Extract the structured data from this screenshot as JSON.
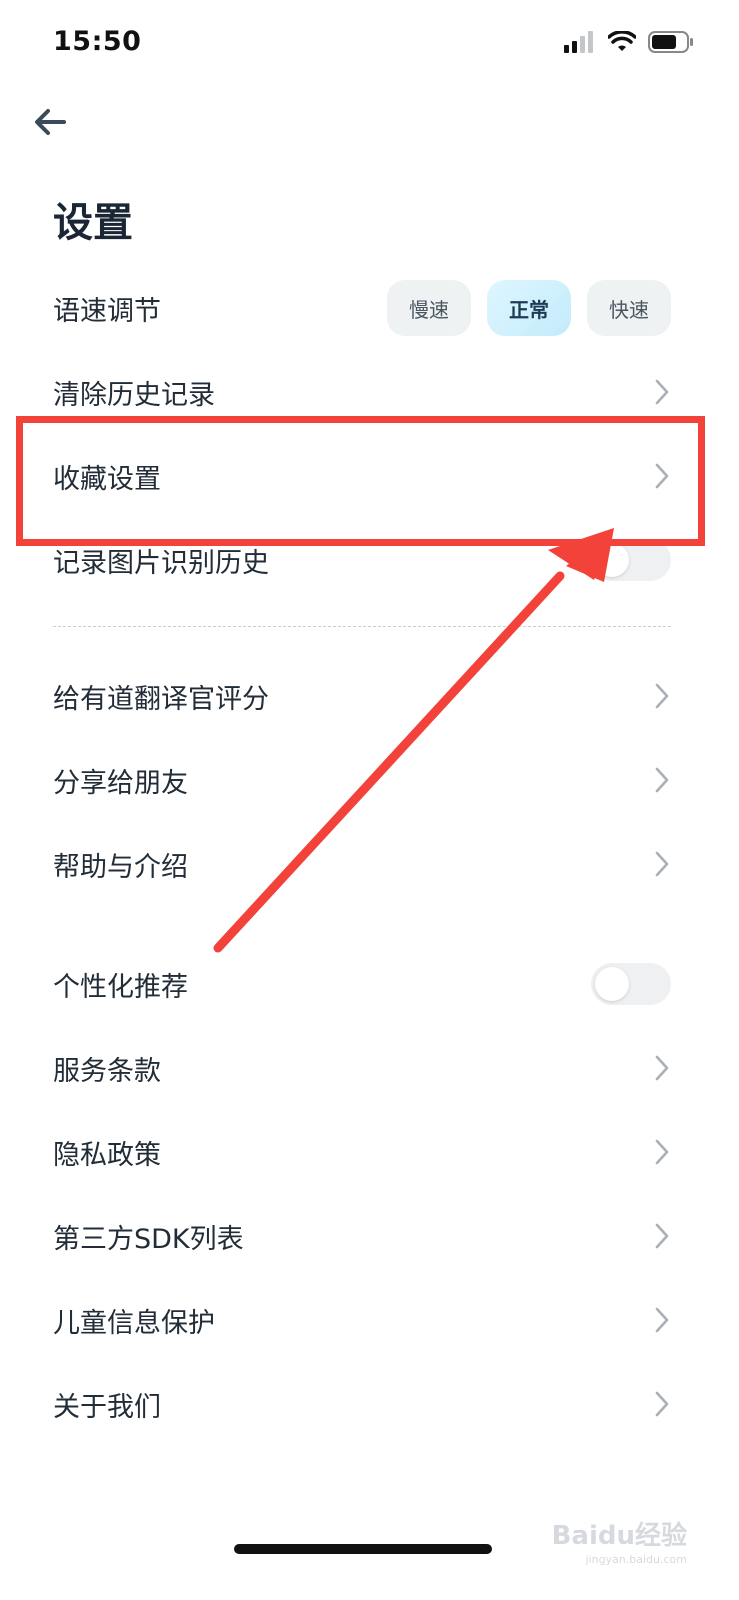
{
  "status_bar": {
    "time": "15:50"
  },
  "header": {
    "title": "设置"
  },
  "speed": {
    "label": "语速调节",
    "options": [
      "慢速",
      "正常",
      "快速"
    ],
    "selected": "正常"
  },
  "rows_group1": [
    {
      "label": "清除历史记录",
      "type": "chevron"
    },
    {
      "label": "收藏设置",
      "type": "chevron"
    },
    {
      "label": "记录图片识别历史",
      "type": "toggle",
      "on": false
    }
  ],
  "rows_group2": [
    {
      "label": "给有道翻译官评分",
      "type": "chevron"
    },
    {
      "label": "分享给朋友",
      "type": "chevron"
    },
    {
      "label": "帮助与介绍",
      "type": "chevron"
    }
  ],
  "rows_group3": [
    {
      "label": "个性化推荐",
      "type": "toggle",
      "on": false
    },
    {
      "label": "服务条款",
      "type": "chevron"
    },
    {
      "label": "隐私政策",
      "type": "chevron"
    },
    {
      "label": "第三方SDK列表",
      "type": "chevron"
    },
    {
      "label": "儿童信息保护",
      "type": "chevron"
    },
    {
      "label": "关于我们",
      "type": "chevron"
    }
  ],
  "annotation": {
    "color": "#f2423a"
  },
  "watermark": {
    "brand": "Baidu经验",
    "url": "jingyan.baidu.com"
  }
}
